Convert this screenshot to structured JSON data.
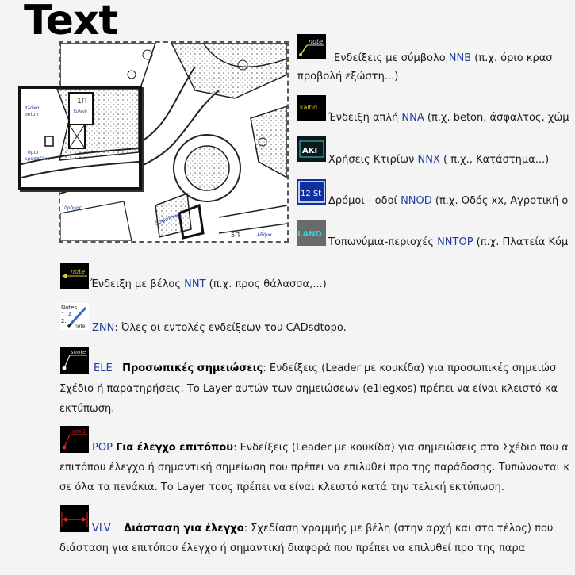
{
  "heading": "Text",
  "map": {
    "labels": {
      "sidewalk": "πλάκα",
      "beton": "beton",
      "curb": "όριο",
      "curb2": "κρασπέδου",
      "asphalt": "άσφαλτος",
      "road": "δρόμος",
      "fl1": "1Π",
      "tag": "Κυλινδ",
      "fl5": "5Π",
      "stamp": "Αθήνα"
    }
  },
  "icons": {
    "nnb": "note",
    "nna": "kaitid",
    "nnx": "AKI",
    "nnod": "12 St",
    "nntop": "LAND",
    "nnt": "note",
    "zn": "Notes",
    "zn1": "1. A",
    "zn2": "2.",
    "zn3": "note",
    "ele": "snote",
    "pop": "note 1"
  },
  "items": [
    {
      "pre": "Ενδείξεις με σύμβολο ",
      "code": "NNB",
      "post": " (π.χ. όριο κρασ",
      "line2": "προβολή εξώστη...)"
    },
    {
      "pre": "Ένδειξη απλή ",
      "code": "NNA",
      "post": " (π.χ. beton, άσφαλτος, χώμ"
    },
    {
      "pre": "Χρήσεις Κτιρίων ",
      "code": "NNX",
      "post": " ( π.χ., Κατάστημα...)"
    },
    {
      "pre": "Δρόμοι - οδοί ",
      "code": "NNOD",
      "post": " (π.χ. Οδός xx, Αγροτική ο"
    },
    {
      "pre": "Τοπωνύμια-περιοχές ",
      "code": "NNTOP",
      "post": " (π.χ. Πλατεία Κόμ"
    },
    {
      "pre": "Ένδειξη με βέλος ",
      "code": "NNT",
      "post": " (π.χ. προς θάλασσα,...)"
    }
  ],
  "zn": {
    "code": "ZNN",
    "text": ":  Όλες οι εντολές ενδείξεων του CADsdtopo."
  },
  "ele": {
    "code": "ELE",
    "title": "Προσωπικές σημειώσεις",
    "line1": ": Ενδείξεις (Leader με κουκίδα) για προσωπικές σημειώσ",
    "line2": "Σχέδιο ή παρατηρήσεις. Το Layer αυτών των σημειώσεων (e1legxos) πρέπει να είναι κλειστό κα",
    "line3": "εκτύπωση."
  },
  "pop": {
    "code": "POP",
    "title": "Για έλεγχο επιτόπου",
    "line1": ":  Ενδείξεις (Leader με κουκίδα) για σημειώσεις στο Σχέδιο που α",
    "line2": "επιτόπου έλεγχο ή σημαντική σημείωση που πρέπει να επιλυθεί προ της παράδοσης. Τυπώνονται κ",
    "line3": "σε όλα τα πενάκια. Το Layer τους πρέπει να είναι κλειστό κατά την τελική εκτύπωση."
  },
  "vlv": {
    "code": "VLV",
    "title": "Διάσταση για έλεγχο",
    "line1": ":  Σχεδίαση γραμμής με βέλη (στην αρχή και στο τέλος) που",
    "line2": "διάσταση για επιτόπου έλεγχο ή σημαντική διαφορά που πρέπει να επιλυθεί προ της παρα"
  }
}
